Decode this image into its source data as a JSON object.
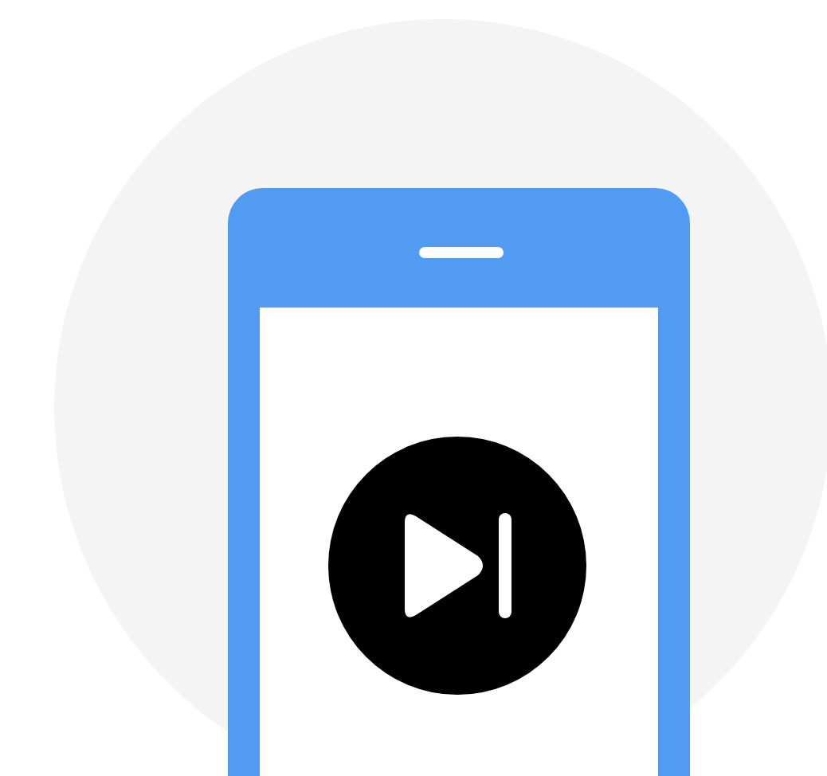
{
  "illustration": {
    "kind": "phone-skip-next"
  }
}
